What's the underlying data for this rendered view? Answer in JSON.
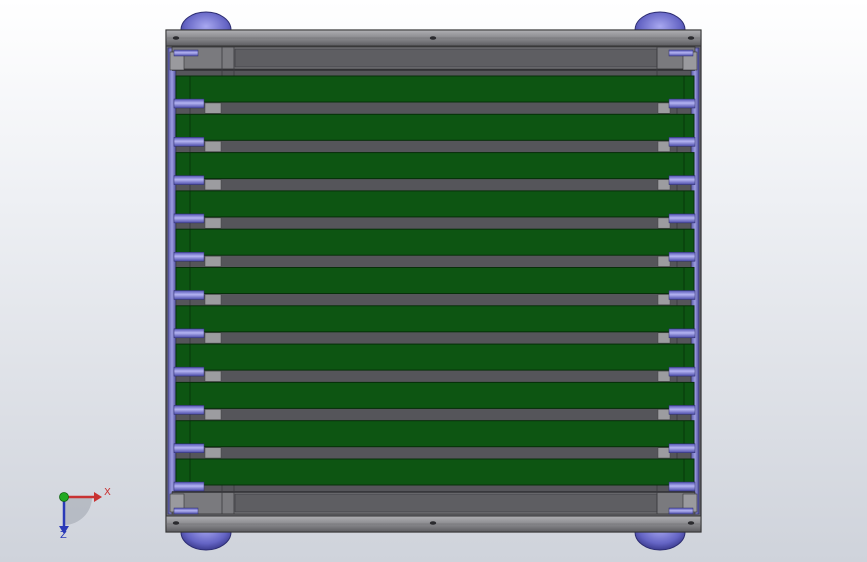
{
  "window": {
    "title": ""
  },
  "model": {
    "type": "conveyor-top-view",
    "belt_count": 11,
    "colors": {
      "background_top": "#ffffff",
      "background_bottom": "#cfd3db",
      "frame": "#8e8e92",
      "frame_dark": "#4a4a4e",
      "deck": "#55555a",
      "belt": "#0d5512",
      "belt_edge": "#062f09",
      "roller_blue": "#6c6ccc",
      "roller_blue_light": "#a6a6ec",
      "wheel": "#6a6ac8",
      "bracket": "#9a9a9e"
    }
  },
  "triad": {
    "x_label": "X",
    "z_label": "Z",
    "x_color": "#c83232",
    "y_color": "#22aa22",
    "z_color": "#2a3ab8"
  }
}
